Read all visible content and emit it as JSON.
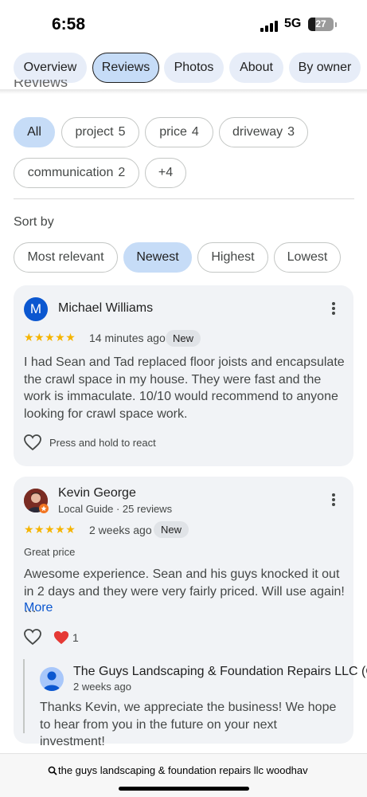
{
  "status_bar": {
    "time": "6:58",
    "network": "5G",
    "battery": "27"
  },
  "tabs": [
    {
      "label": "Overview"
    },
    {
      "label": "Reviews",
      "active": true
    },
    {
      "label": "Photos"
    },
    {
      "label": "About"
    },
    {
      "label": "By owner"
    }
  ],
  "section_title_partial": "Reviews",
  "filters": [
    {
      "label": "All",
      "count": "",
      "selected": true
    },
    {
      "label": "project",
      "count": "5"
    },
    {
      "label": "price",
      "count": "4"
    },
    {
      "label": "driveway",
      "count": "3"
    },
    {
      "label": "communication",
      "count": "2"
    },
    {
      "label": "+4",
      "count": ""
    }
  ],
  "sort": {
    "label": "Sort by",
    "options": [
      {
        "label": "Most relevant"
      },
      {
        "label": "Newest",
        "selected": true
      },
      {
        "label": "Highest"
      },
      {
        "label": "Lowest"
      }
    ]
  },
  "reviews": [
    {
      "author": "Michael Williams",
      "avatar_letter": "M",
      "avatar_color": "#0b57d0",
      "rating": 5,
      "stars": "★★★★★",
      "time": "14 minutes ago",
      "badge": "New",
      "text": "I had Sean and Tad replaced floor joists and encapsulate the crawl space in my house. They were fast and the work is immaculate. 10/10 would recommend to anyone looking for crawl space work.",
      "react_hint": "Press and hold to react"
    },
    {
      "author": "Kevin George",
      "subtitle": "Local Guide · 25 reviews",
      "rating": 5,
      "stars": "★★★★★",
      "time": "2 weeks ago",
      "badge": "New",
      "highlight": "Great price",
      "text": "Awesome experience. Sean and his guys knocked it out in 2 days and they were very fairly priced. Will use again! …",
      "more_label": "More",
      "reaction_count": "1",
      "owner_reply": {
        "name": "The Guys Landscaping & Foundation Repairs LLC (Ow",
        "time": "2 weeks ago",
        "text": "Thanks Kevin, we appreciate the business! We hope to hear from you in the future on your next investment!"
      }
    }
  ],
  "address_bar": {
    "text": "the guys landscaping & foundation repairs llc woodhav"
  },
  "colors": {
    "accent": "#0b57d0",
    "chip_selected": "#c6dcf7",
    "star": "#f5b400",
    "card": "#f1f3f6"
  }
}
